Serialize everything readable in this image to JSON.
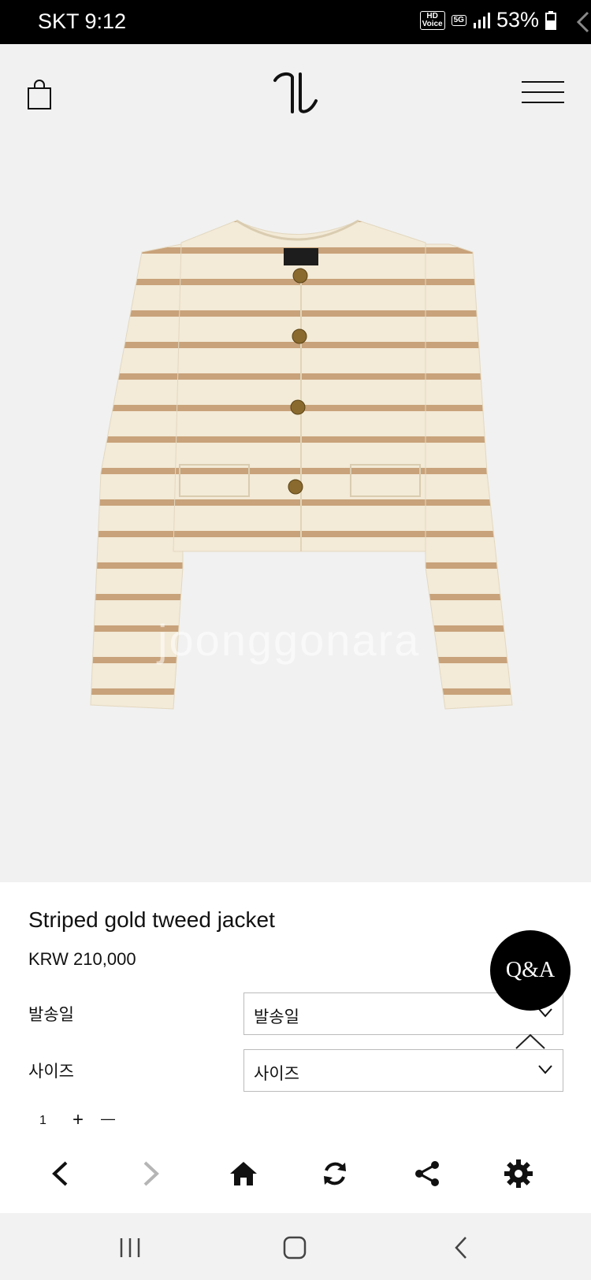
{
  "status_bar": {
    "carrier_time": "SKT 9:12",
    "hd_badge": "HD Voice",
    "network": "5G",
    "battery": "53%"
  },
  "header": {
    "logo_text": "TL",
    "bag_icon": "shopping-bag-icon",
    "menu_icon": "hamburger-menu-icon"
  },
  "hero": {
    "image_description": "striped-cream-tweed-jacket",
    "watermark": "joonggonara"
  },
  "product": {
    "title": "Striped gold tweed jacket",
    "price": "KRW 210,000",
    "options": [
      {
        "label": "발송일",
        "selected": "발송일"
      },
      {
        "label": "사이즈",
        "selected": "사이즈"
      }
    ],
    "quantity": "1",
    "qty_plus": "+",
    "qty_minus": "—"
  },
  "floating": {
    "qa_label": "Q&A"
  },
  "toolbar": {
    "icons": [
      "back-icon",
      "forward-icon",
      "home-icon",
      "refresh-icon",
      "share-icon",
      "settings-icon"
    ]
  },
  "colors": {
    "hero_bg": "#f1f1f1",
    "stripe": "#c8a27a",
    "fabric": "#f3ead7",
    "qa_bg": "#000000"
  }
}
